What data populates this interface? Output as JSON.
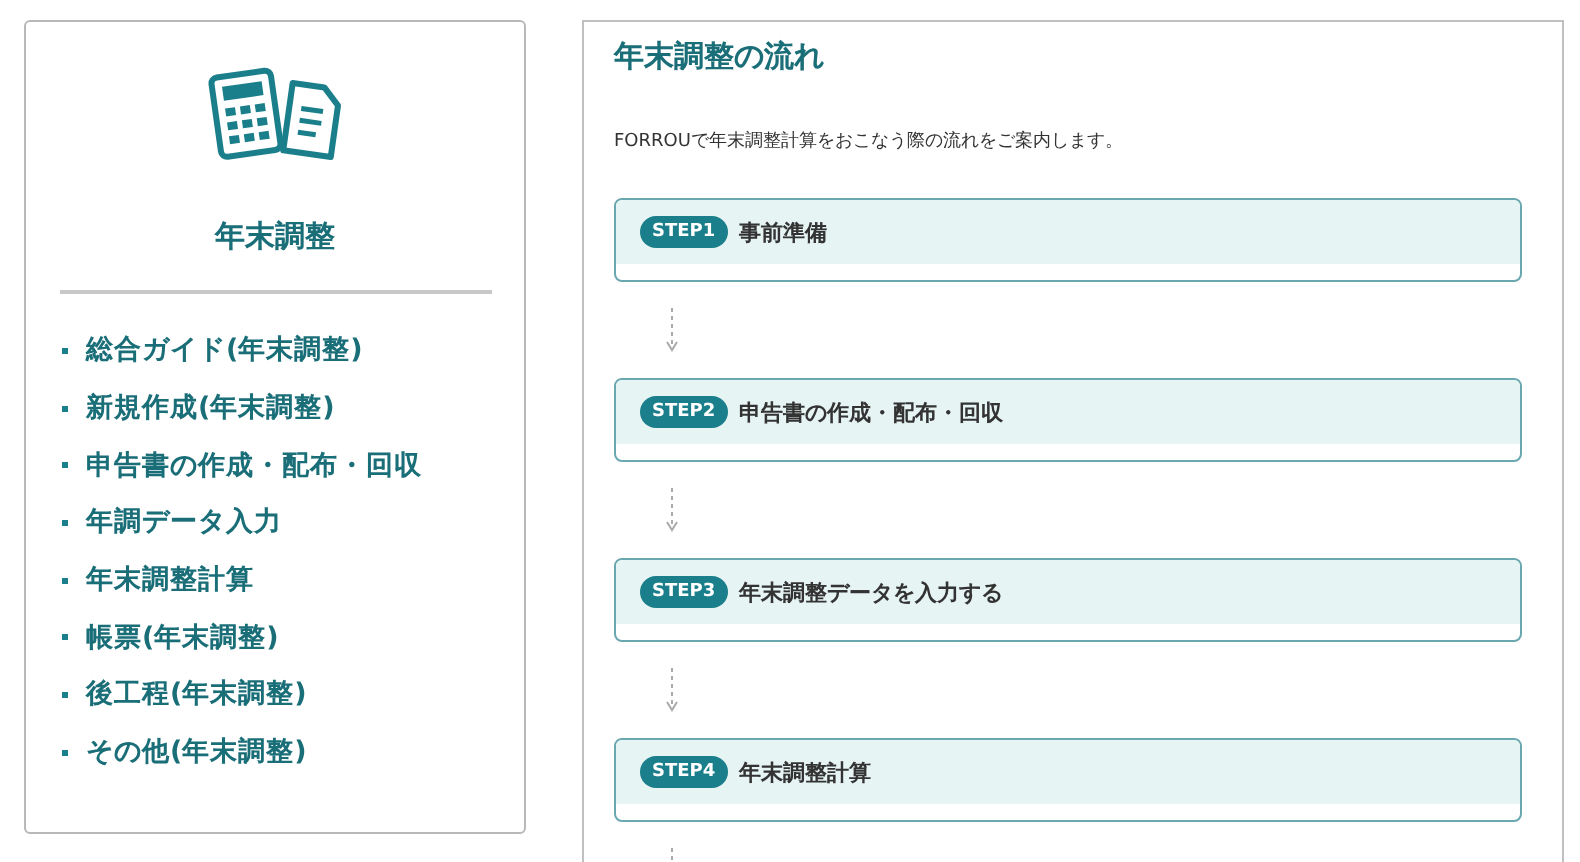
{
  "sidebar": {
    "title": "年末調整",
    "items": [
      {
        "label": "総合ガイド(年末調整)"
      },
      {
        "label": "新規作成(年末調整)"
      },
      {
        "label": "申告書の作成・配布・回収"
      },
      {
        "label": "年調データ入力"
      },
      {
        "label": "年末調整計算"
      },
      {
        "label": "帳票(年末調整)"
      },
      {
        "label": "後工程(年末調整)"
      },
      {
        "label": "その他(年末調整)"
      }
    ]
  },
  "main": {
    "title": "年末調整の流れ",
    "intro": "FORROUで年末調整計算をおこなう際の流れをご案内します。",
    "steps": [
      {
        "badge": "STEP1",
        "title": "事前準備"
      },
      {
        "badge": "STEP2",
        "title": "申告書の作成・配布・回収"
      },
      {
        "badge": "STEP3",
        "title": "年末調整データを入力する"
      },
      {
        "badge": "STEP4",
        "title": "年末調整計算"
      }
    ]
  }
}
